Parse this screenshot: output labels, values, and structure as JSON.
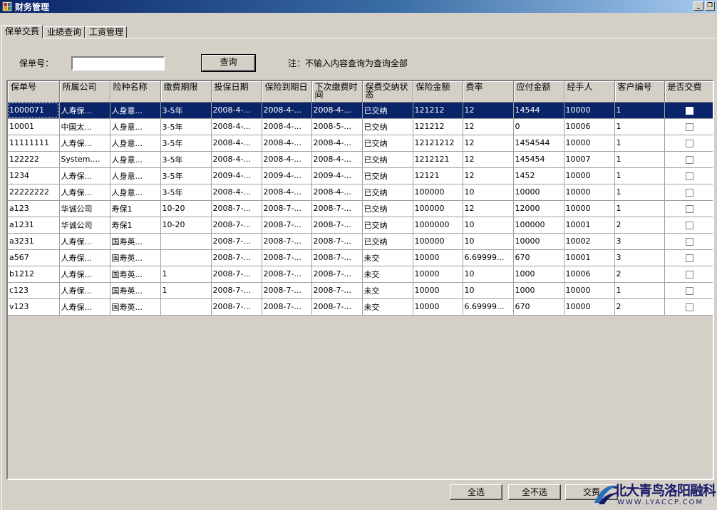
{
  "window": {
    "title": "财务管理",
    "min_glyph": "_",
    "restore_glyph": "❐"
  },
  "tabs": [
    {
      "label": "保单交费"
    },
    {
      "label": "业绩查询"
    },
    {
      "label": "工资管理"
    }
  ],
  "search": {
    "label": "保单号：",
    "value": "",
    "button": "查询",
    "note": "注：不输入内容查询为查询全部"
  },
  "grid": {
    "columns": [
      "保单号",
      "所属公司",
      "险种名称",
      "缴费期限",
      "投保日期",
      "保险到期日",
      "下次缴费时间",
      "保费交纳状态",
      "保险金额",
      "费率",
      "应付金额",
      "经手人",
      "客户编号",
      "是否交费"
    ],
    "rows": [
      [
        "1000071",
        "人寿保...",
        "人身意...",
        "3-5年",
        "2008-4-...",
        "2008-4-...",
        "2008-4-...",
        "已交纳",
        "121212",
        "12",
        "14544",
        "10000",
        "1"
      ],
      [
        "10001",
        "中国太...",
        "人身意...",
        "3-5年",
        "2008-4-...",
        "2008-4-...",
        "2008-5-...",
        "已交纳",
        "121212",
        "12",
        "0",
        "10006",
        "1"
      ],
      [
        "11111111",
        "人寿保...",
        "人身意...",
        "3-5年",
        "2008-4-...",
        "2008-4-...",
        "2008-4-...",
        "已交纳",
        "12121212",
        "12",
        "1454544",
        "10000",
        "1"
      ],
      [
        "122222",
        "System....",
        "人身意...",
        "3-5年",
        "2008-4-...",
        "2008-4-...",
        "2008-4-...",
        "已交纳",
        "1212121",
        "12",
        "145454",
        "10007",
        "1"
      ],
      [
        "1234",
        "人寿保...",
        "人身意...",
        "3-5年",
        "2009-4-...",
        "2009-4-...",
        "2009-4-...",
        "已交纳",
        "12121",
        "12",
        "1452",
        "10000",
        "1"
      ],
      [
        "22222222",
        "人寿保...",
        "人身意...",
        "3-5年",
        "2008-4-...",
        "2008-4-...",
        "2008-4-...",
        "已交纳",
        "100000",
        "10",
        "10000",
        "10000",
        "1"
      ],
      [
        "a123",
        "华诚公司",
        "寿保1",
        "10-20",
        "2008-7-...",
        "2008-7-...",
        "2008-7-...",
        "已交纳",
        "100000",
        "12",
        "12000",
        "10000",
        "1"
      ],
      [
        "a1231",
        "华诚公司",
        "寿保1",
        "10-20",
        "2008-7-...",
        "2008-7-...",
        "2008-7-...",
        "已交纳",
        "1000000",
        "10",
        "100000",
        "10001",
        "2"
      ],
      [
        "a3231",
        "人寿保...",
        "国寿英...",
        "",
        "2008-7-...",
        "2008-7-...",
        "2008-7-...",
        "已交纳",
        "100000",
        "10",
        "10000",
        "10002",
        "3"
      ],
      [
        "a567",
        "人寿保...",
        "国寿英...",
        "",
        "2008-7-...",
        "2008-7-...",
        "2008-7-...",
        "未交",
        "10000",
        "6.69999...",
        "670",
        "10001",
        "3"
      ],
      [
        "b1212",
        "人寿保...",
        "国寿英...",
        "1",
        "2008-7-...",
        "2008-7-...",
        "2008-7-...",
        "未交",
        "10000",
        "10",
        "1000",
        "10006",
        "2"
      ],
      [
        "c123",
        "人寿保...",
        "国寿英...",
        "1",
        "2008-7-...",
        "2008-7-...",
        "2008-7-...",
        "未交",
        "10000",
        "10",
        "1000",
        "10000",
        "1"
      ],
      [
        "v123",
        "人寿保...",
        "国寿英...",
        "",
        "2008-7-...",
        "2008-7-...",
        "2008-7-...",
        "未交",
        "10000",
        "6.69999...",
        "670",
        "10000",
        "2"
      ]
    ]
  },
  "buttons": {
    "select_all": "全选",
    "select_none": "全不选",
    "pay": "交费"
  },
  "watermark": {
    "text": "北大青鸟洛阳融科",
    "url": "WWW.LYACCP.COM"
  },
  "colors": {
    "selection": "#0a246a",
    "face": "#d4d0c8"
  }
}
